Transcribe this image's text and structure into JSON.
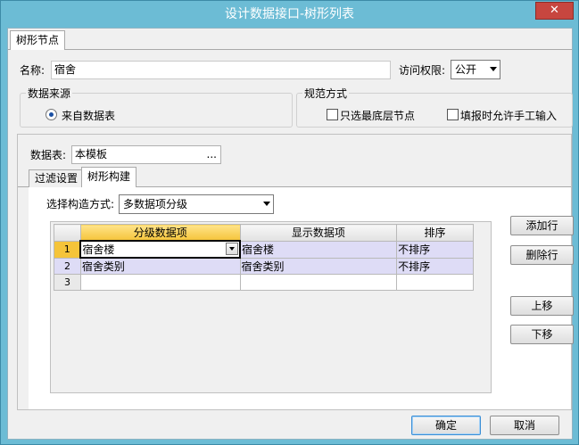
{
  "window": {
    "title": "设计数据接口-树形列表",
    "close_label": "✕"
  },
  "top_tab": {
    "label": "树形节点"
  },
  "name_field": {
    "label": "名称:",
    "value": "宿舍"
  },
  "access": {
    "label": "访问权限:",
    "value": "公开"
  },
  "data_source": {
    "legend": "数据来源",
    "radio_label": "来自数据表"
  },
  "norms": {
    "legend": "规范方式",
    "check1": "只选最底层节点",
    "check2": "填报时允许手工输入"
  },
  "data_table": {
    "label": "数据表:",
    "value": "本模板",
    "browse": "..."
  },
  "inner_tabs": [
    "过滤设置",
    "树形构建"
  ],
  "build_method": {
    "label": "选择构造方式:",
    "value": "多数据项分级"
  },
  "grid": {
    "columns": [
      "分级数据项",
      "显示数据项",
      "排序"
    ],
    "rows": [
      {
        "num": "1",
        "level": "宿舍楼",
        "display": "宿舍楼",
        "sort": "不排序"
      },
      {
        "num": "2",
        "level": "宿舍类别",
        "display": "宿舍类别",
        "sort": "不排序"
      },
      {
        "num": "3",
        "level": "",
        "display": "",
        "sort": ""
      }
    ]
  },
  "side_buttons": {
    "add": "添加行",
    "delete": "删除行",
    "up": "上移",
    "down": "下移"
  },
  "footer": {
    "ok": "确定",
    "cancel": "取消"
  }
}
